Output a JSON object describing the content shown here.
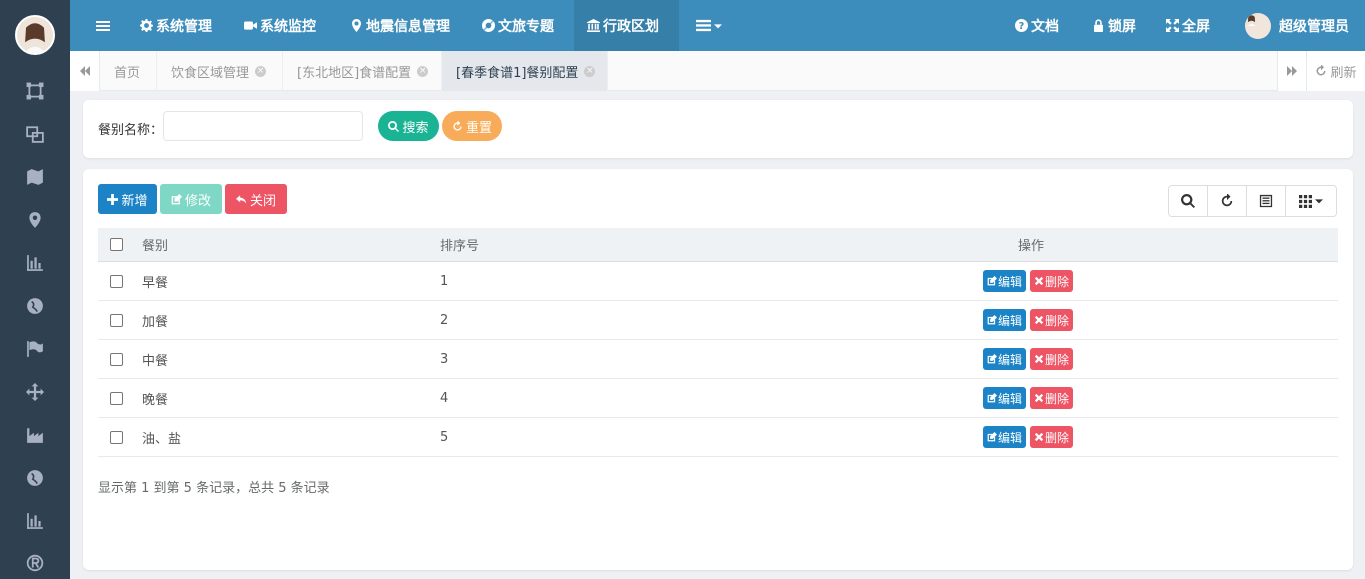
{
  "topnav": {
    "items": [
      {
        "label": "系统管理",
        "icon": "gear-icon"
      },
      {
        "label": "系统监控",
        "icon": "video-camera-icon"
      },
      {
        "label": "地震信息管理",
        "icon": "map-marker-icon"
      },
      {
        "label": "文旅专题",
        "icon": "life-ring-icon"
      },
      {
        "label": "行政区划",
        "icon": "bank-icon"
      }
    ],
    "docs_label": "文档",
    "lock_label": "锁屏",
    "fullscreen_label": "全屏",
    "user_name": "超级管理员"
  },
  "tabs": {
    "items": [
      {
        "label": "首页"
      },
      {
        "label": "饮食区域管理"
      },
      {
        "label": "[东北地区]食谱配置"
      },
      {
        "label": "[春季食谱1]餐别配置"
      }
    ],
    "refresh_label": "刷新"
  },
  "search": {
    "label": "餐别名称：",
    "value": "",
    "placeholder": "",
    "search_label": "搜索",
    "reset_label": "重置"
  },
  "toolbar": {
    "add_label": "新增",
    "edit_label": "修改",
    "close_label": "关闭"
  },
  "table": {
    "headers": [
      "餐别",
      "排序号",
      "操作"
    ],
    "rows": [
      {
        "name": "早餐",
        "order": "1"
      },
      {
        "name": "加餐",
        "order": "2"
      },
      {
        "name": "中餐",
        "order": "3"
      },
      {
        "name": "晚餐",
        "order": "4"
      },
      {
        "name": "油、盐",
        "order": "5"
      }
    ],
    "edit_label": "编辑",
    "delete_label": "删除"
  },
  "pager": {
    "summary": "显示第 1 到第 5 条记录，总共 5 条记录"
  },
  "colors": {
    "topnav": "#3c8dbc",
    "sidebar": "#2f4050",
    "primary": "#1c84c6",
    "success": "#1ab394",
    "warning": "#f8ac59",
    "danger": "#ed5565"
  }
}
